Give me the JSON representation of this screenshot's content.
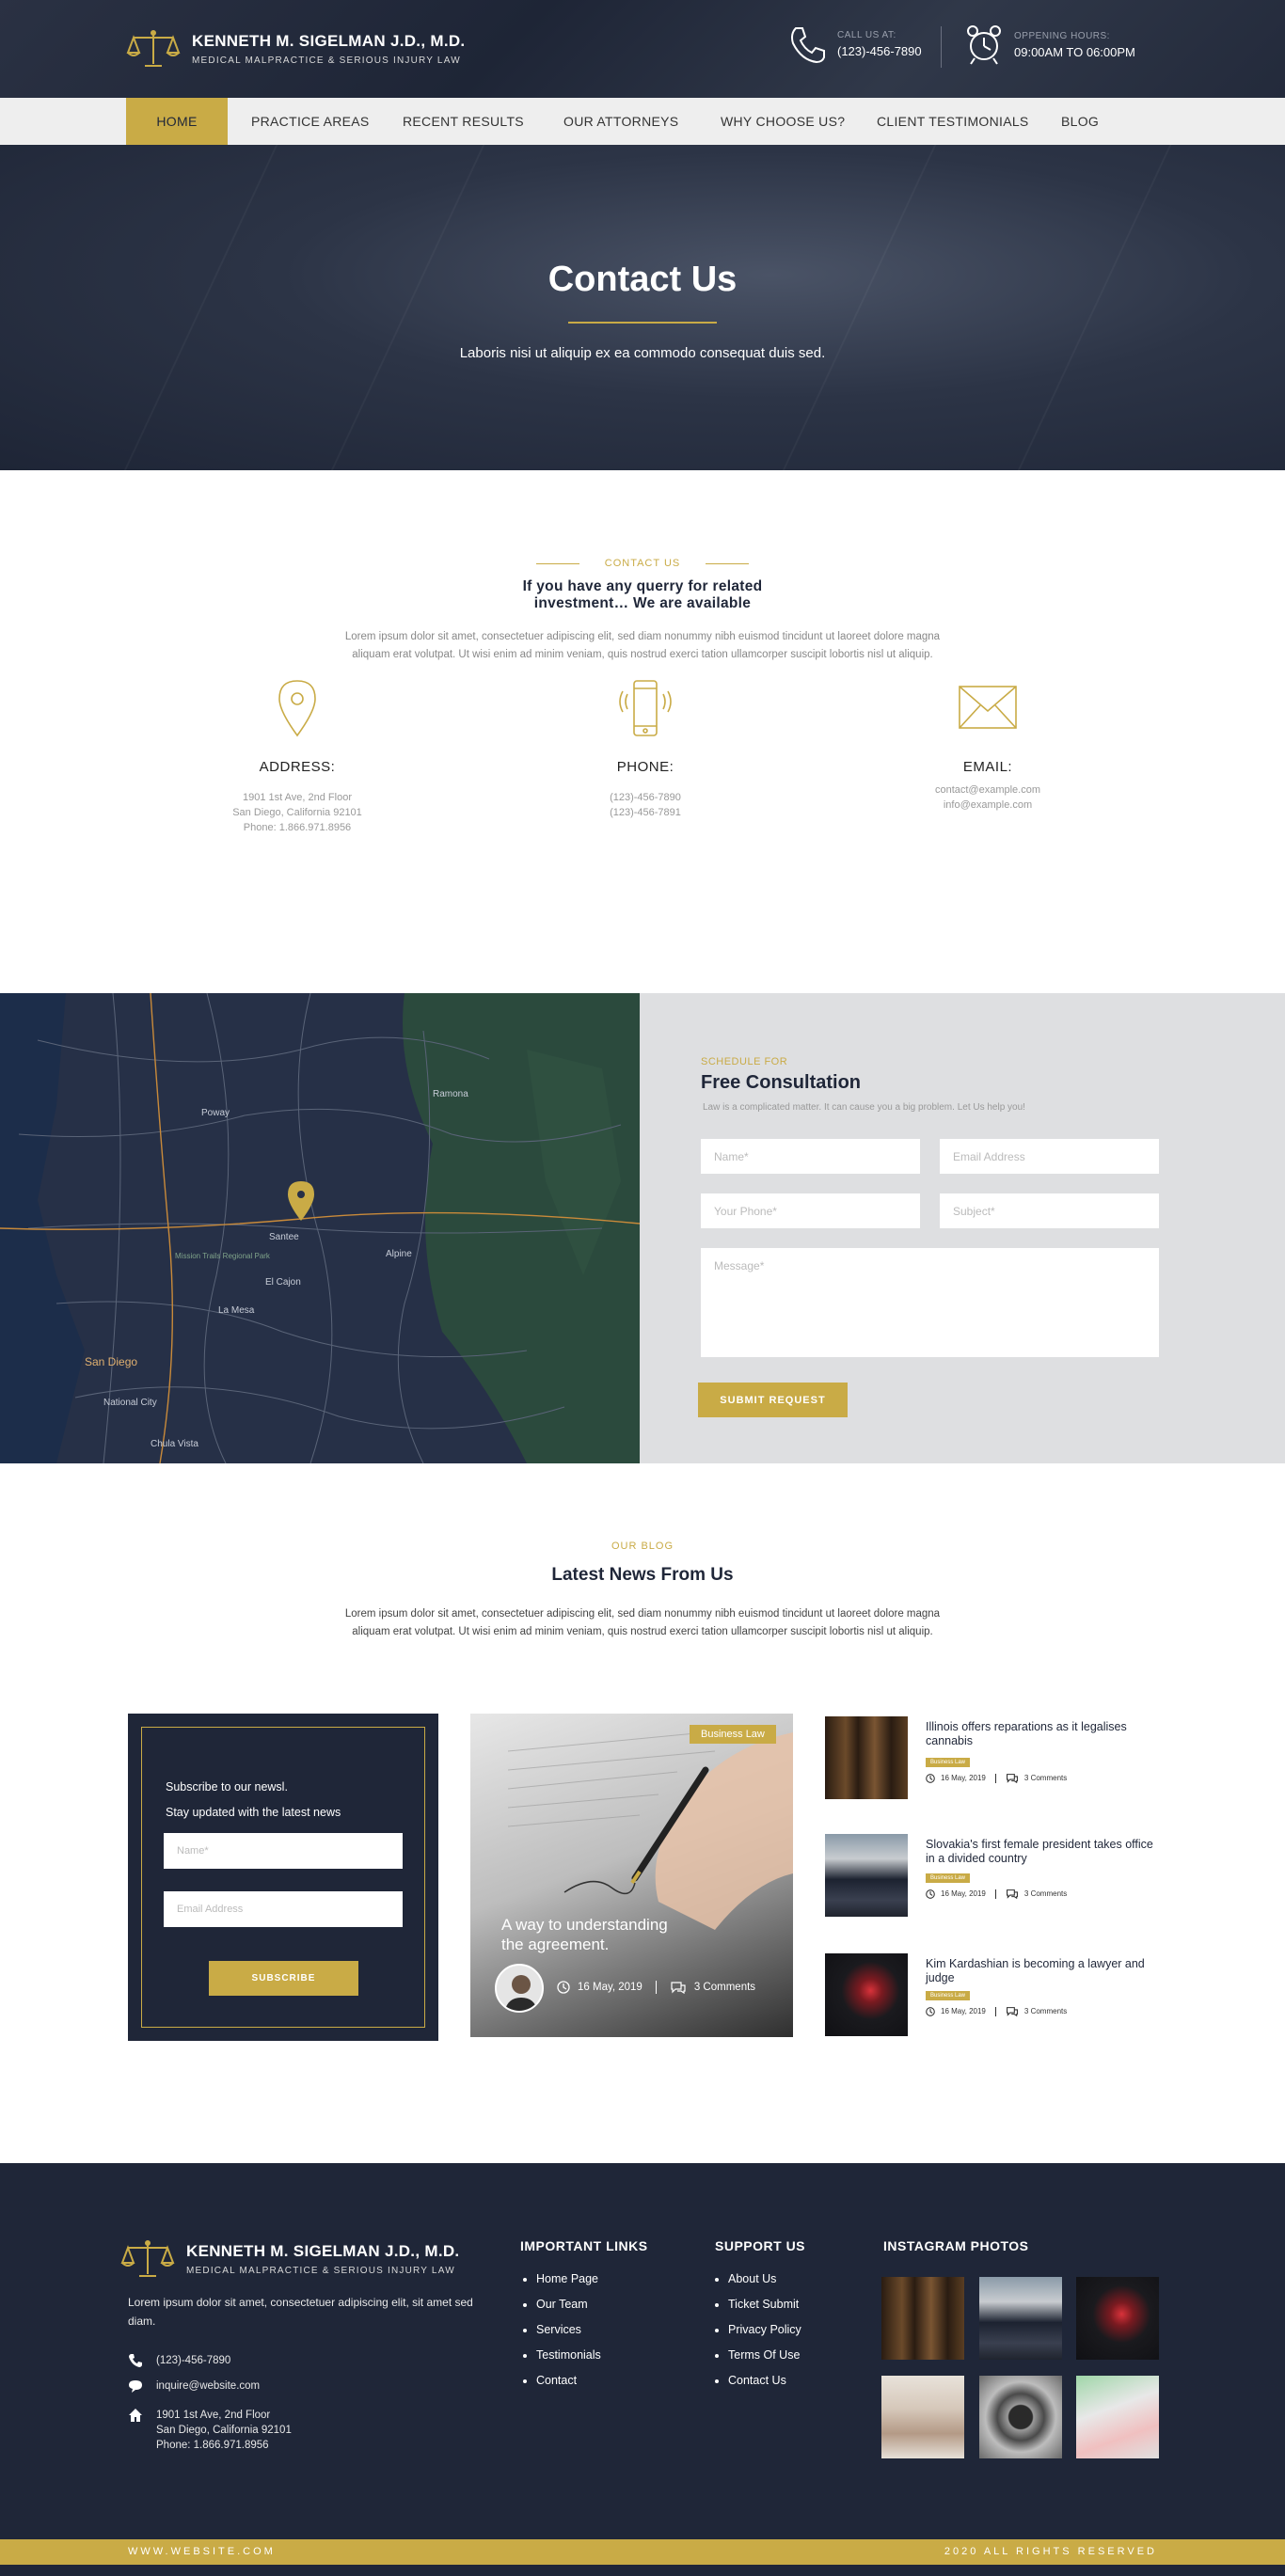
{
  "brand": {
    "name": "KENNETH M. SIGELMAN J.D., M.D.",
    "tagline": "MEDICAL MALPRACTICE & SERIOUS INJURY LAW"
  },
  "header": {
    "call_label": "CALL US AT:",
    "call_value": "(123)-456-7890",
    "hours_label": "OPPENING HOURS:",
    "hours_value": "09:00AM TO 06:00PM"
  },
  "nav": {
    "items": [
      "HOME",
      "PRACTICE AREAS",
      "RECENT RESULTS",
      "OUR ATTORNEYS",
      "WHY CHOOSE US?",
      "CLIENT TESTIMONIALS",
      "BLOG"
    ],
    "active": "HOME"
  },
  "hero": {
    "title": "Contact Us",
    "subtitle": "Laboris nisi ut aliquip ex ea commodo consequat duis sed."
  },
  "contact": {
    "kicker": "CONTACT US",
    "title_line1": "If you have any querry for related",
    "title_line2": "investment… We are available",
    "lorem_line1": "Lorem ipsum dolor sit amet, consectetuer adipiscing elit, sed diam nonummy nibh euismod tincidunt ut laoreet dolore magna",
    "lorem_line2": "aliquam erat volutpat. Ut wisi enim ad minim veniam, quis nostrud exerci tation ullamcorper suscipit lobortis nisl ut aliquip.",
    "address": {
      "title": "ADDRESS:",
      "lines": [
        "1901 1st Ave, 2nd Floor",
        "San Diego, California 92101",
        "Phone: 1.866.971.8956"
      ]
    },
    "phone": {
      "title": "PHONE:",
      "lines": [
        "(123)-456-7890",
        "(123)-456-7891"
      ]
    },
    "email": {
      "title": "EMAIL:",
      "lines": [
        "contact@example.com",
        "info@example.com"
      ]
    }
  },
  "map": {
    "labels": {
      "santee": "Santee",
      "sandiego": "San Diego",
      "elcajon": "El Cajon",
      "lamesa": "La Mesa",
      "chulavista": "Chula Vista",
      "alpine": "Alpine",
      "poway": "Poway",
      "ramona": "Ramona",
      "nationalcity": "National City",
      "mission": "Mission Trails Regional Park"
    }
  },
  "consult": {
    "kicker": "SCHEDULE FOR",
    "title": "Free Consultation",
    "desc": "Law is a complicated matter. It can cause you a big problem. Let Us help you!",
    "name_ph": "Name*",
    "email_ph": "Email Address",
    "phone_ph": "Your Phone*",
    "subject_ph": "Subject*",
    "message_ph": "Message*",
    "submit": "SUBMIT REQUEST"
  },
  "blog": {
    "kicker": "OUR BLOG",
    "title": "Latest News From Us",
    "lorem_line1": "Lorem ipsum dolor sit amet, consectetuer adipiscing elit, sed diam nonummy nibh euismod tincidunt ut laoreet dolore magna",
    "lorem_line2": "aliquam erat volutpat. Ut wisi enim ad minim veniam, quis nostrud exerci tation ullamcorper suscipit lobortis nisl ut aliquip."
  },
  "newsletter": {
    "line1": "Subscribe to our newsl.",
    "line2": "Stay updated with the latest news",
    "name_ph": "Name*",
    "email_ph": "Email Address",
    "button": "SUBSCRIBE"
  },
  "featured": {
    "tag": "Business Law",
    "title_line1": "A way to understanding",
    "title_line2": "the agreement.",
    "date": "16 May, 2019",
    "comments": "3 Comments"
  },
  "side_posts": [
    {
      "title": "Illinois offers reparations as it legalises cannabis",
      "tag": "Business Law",
      "date": "16 May, 2019",
      "comments": "3 Comments"
    },
    {
      "title": "Slovakia's first female president takes office in a divided country",
      "tag": "Business Law",
      "date": "16 May, 2019",
      "comments": "3 Comments"
    },
    {
      "title": "Kim Kardashian is becoming a lawyer and judge",
      "tag": "Business Law",
      "date": "16 May, 2019",
      "comments": "3 Comments"
    }
  ],
  "footer": {
    "about": "Lorem ipsum dolor sit amet, consectetuer adipiscing elit,  sit amet sed diam.",
    "phone": "(123)-456-7890",
    "email": "inquire@website.com",
    "addr1": "1901 1st Ave, 2nd Floor",
    "addr2": "San Diego, California 92101",
    "addr3": "Phone: 1.866.971.8956",
    "important_title": "IMPORTANT LINKS",
    "important": [
      "Home Page",
      "Our Team",
      "Services",
      "Testimonials",
      "Contact"
    ],
    "support_title": "SUPPORT US",
    "support": [
      "About Us",
      "Ticket Submit",
      "Privacy Policy",
      "Terms Of Use",
      "Contact Us"
    ],
    "insta_title": "INSTAGRAM PHOTOS"
  },
  "bottom": {
    "website": "WWW.WEBSITE.COM",
    "rights": "2020 ALL RIGHTS RESERVED"
  },
  "colors": {
    "navy": "#1f2638",
    "gold": "#c9ab46",
    "light": "#eeeeee"
  }
}
